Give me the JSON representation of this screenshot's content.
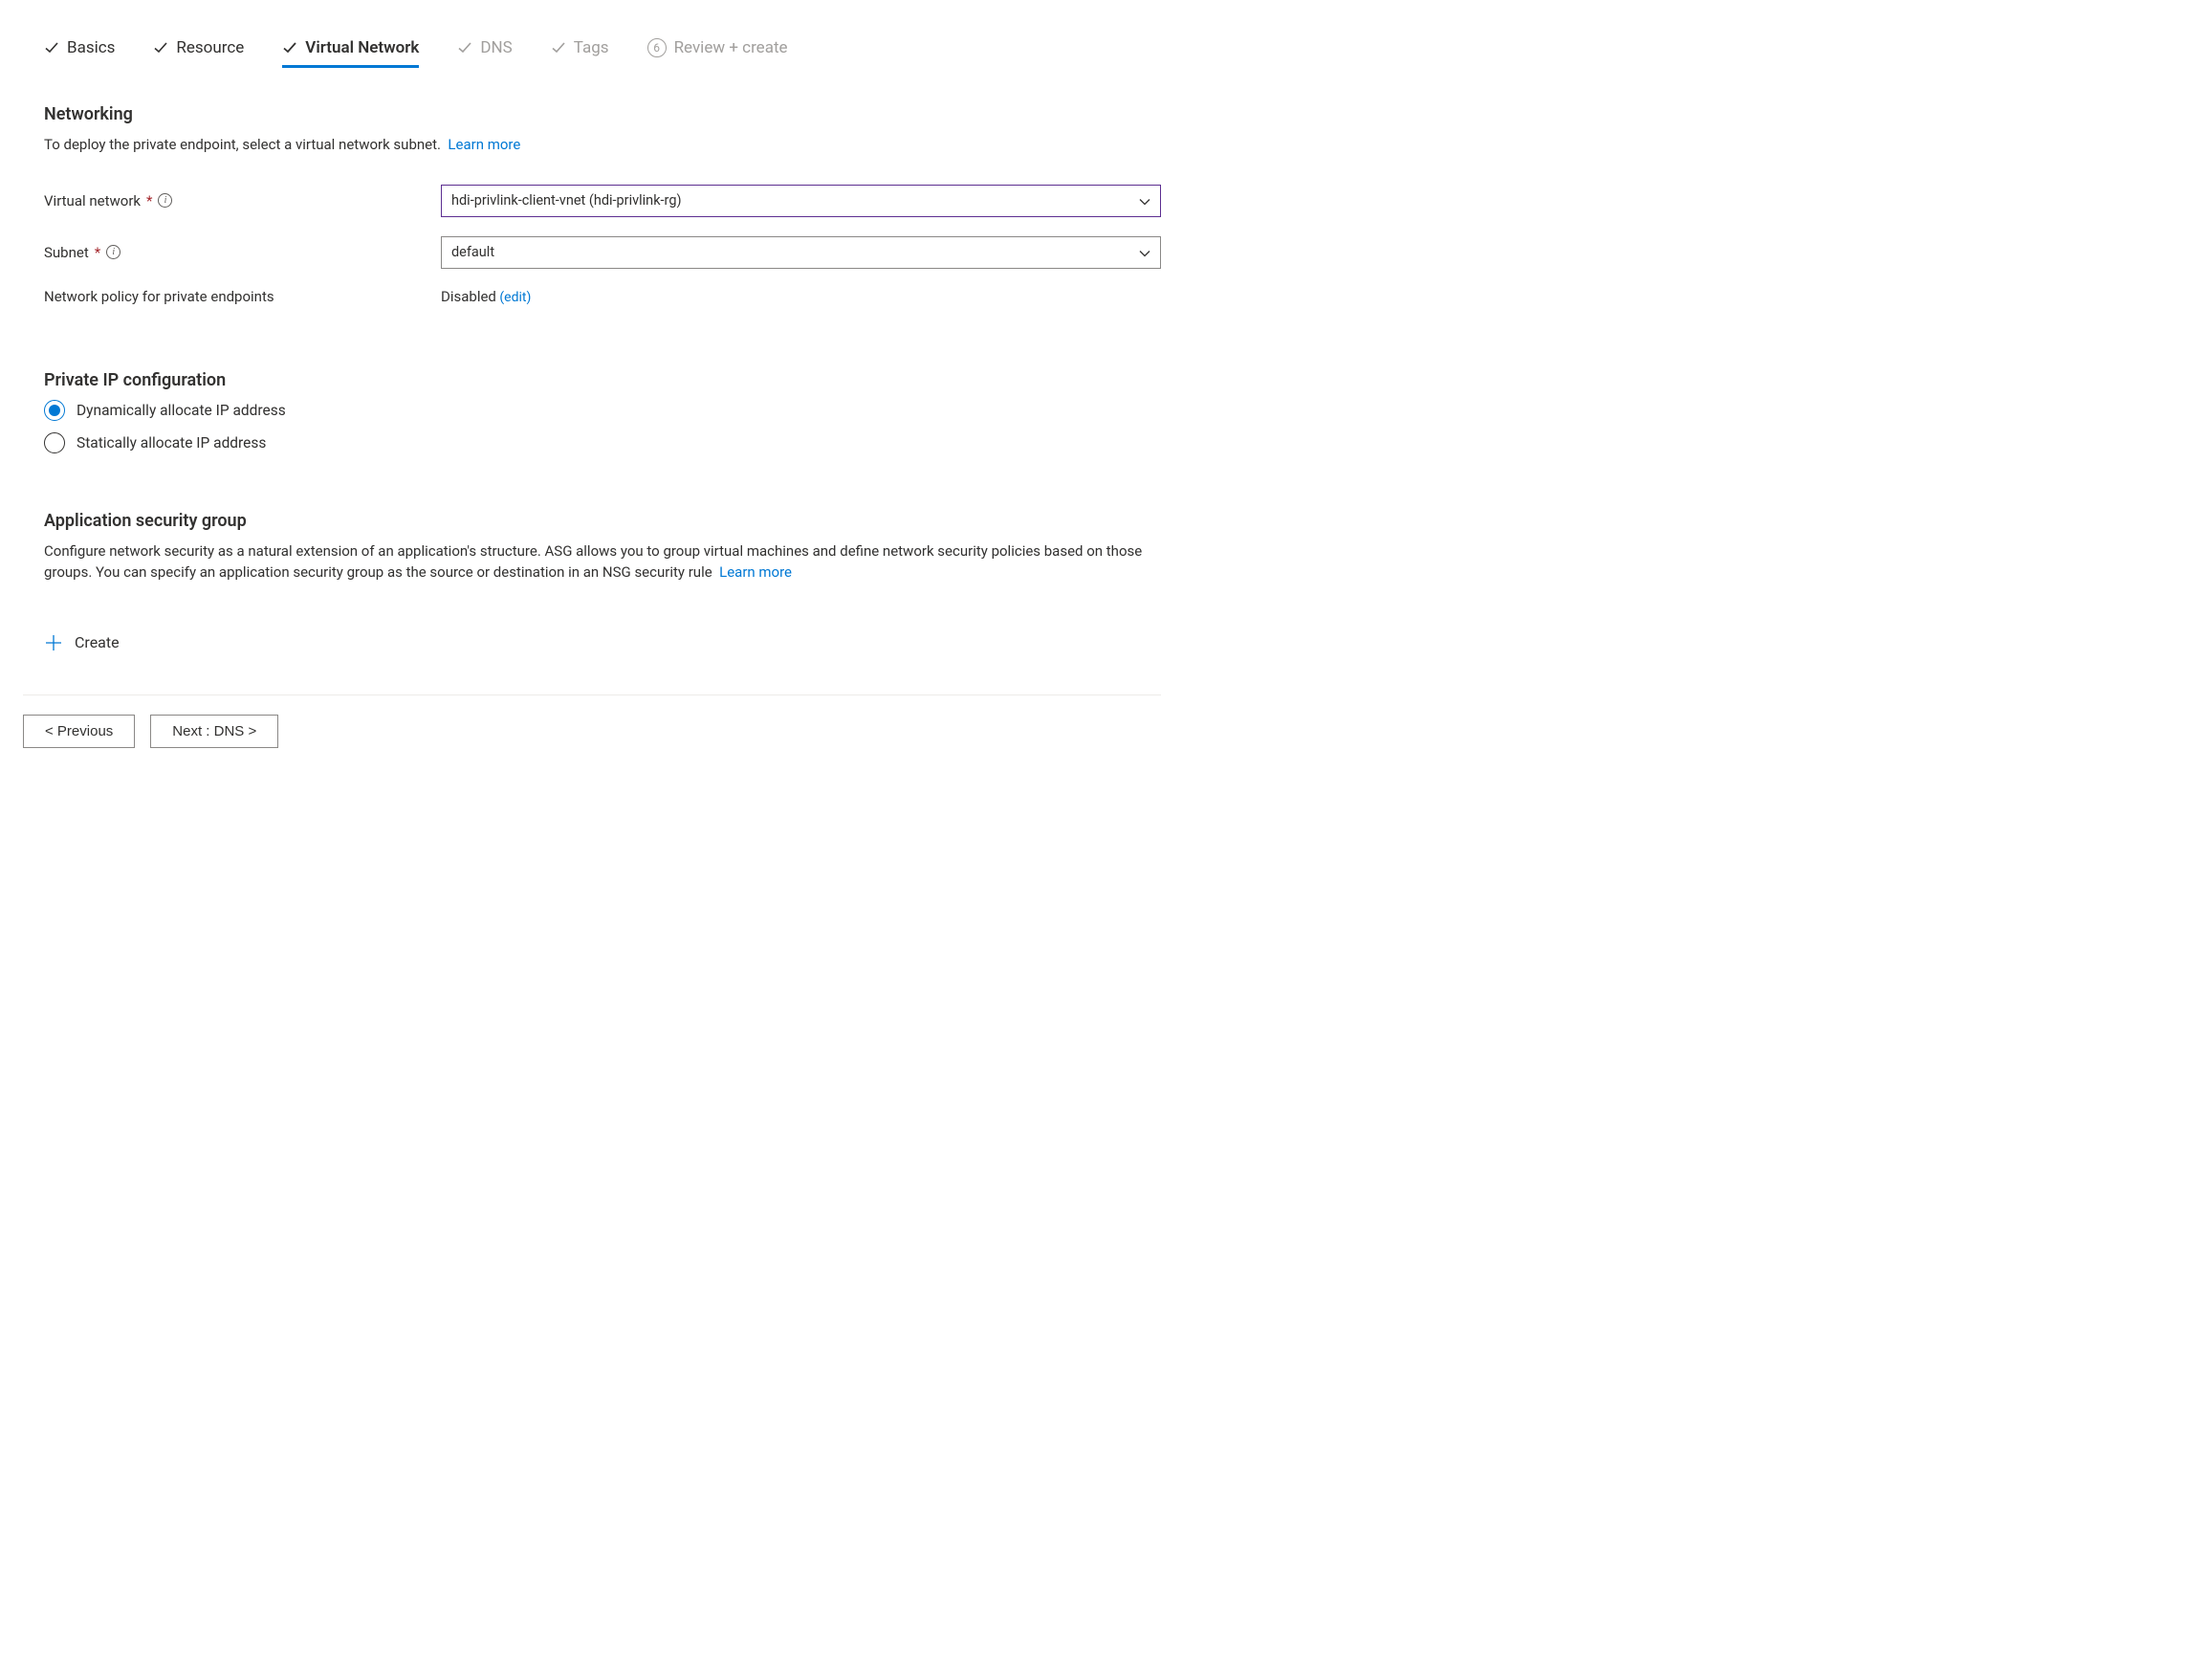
{
  "tabs": {
    "basics": "Basics",
    "resource": "Resource",
    "virtual_network": "Virtual Network",
    "dns": "DNS",
    "tags": "Tags",
    "review_create_number": "6",
    "review_create": "Review + create"
  },
  "networking": {
    "title": "Networking",
    "desc": "To deploy the private endpoint, select a virtual network subnet.",
    "learn_more": "Learn more",
    "vnet_label": "Virtual network",
    "vnet_value": "hdi-privlink-client-vnet (hdi-privlink-rg)",
    "subnet_label": "Subnet",
    "subnet_value": "default",
    "policy_label": "Network policy for private endpoints",
    "policy_value": "Disabled",
    "policy_edit": "(edit)"
  },
  "private_ip": {
    "title": "Private IP configuration",
    "opt_dynamic": "Dynamically allocate IP address",
    "opt_static": "Statically allocate IP address"
  },
  "asg": {
    "title": "Application security group",
    "desc": "Configure network security as a natural extension of an application's structure. ASG allows you to group virtual machines and define network security policies based on those groups. You can specify an application security group as the source or destination in an NSG security rule",
    "learn_more": "Learn more",
    "create": "Create"
  },
  "footer": {
    "previous": "< Previous",
    "next": "Next : DNS >"
  }
}
